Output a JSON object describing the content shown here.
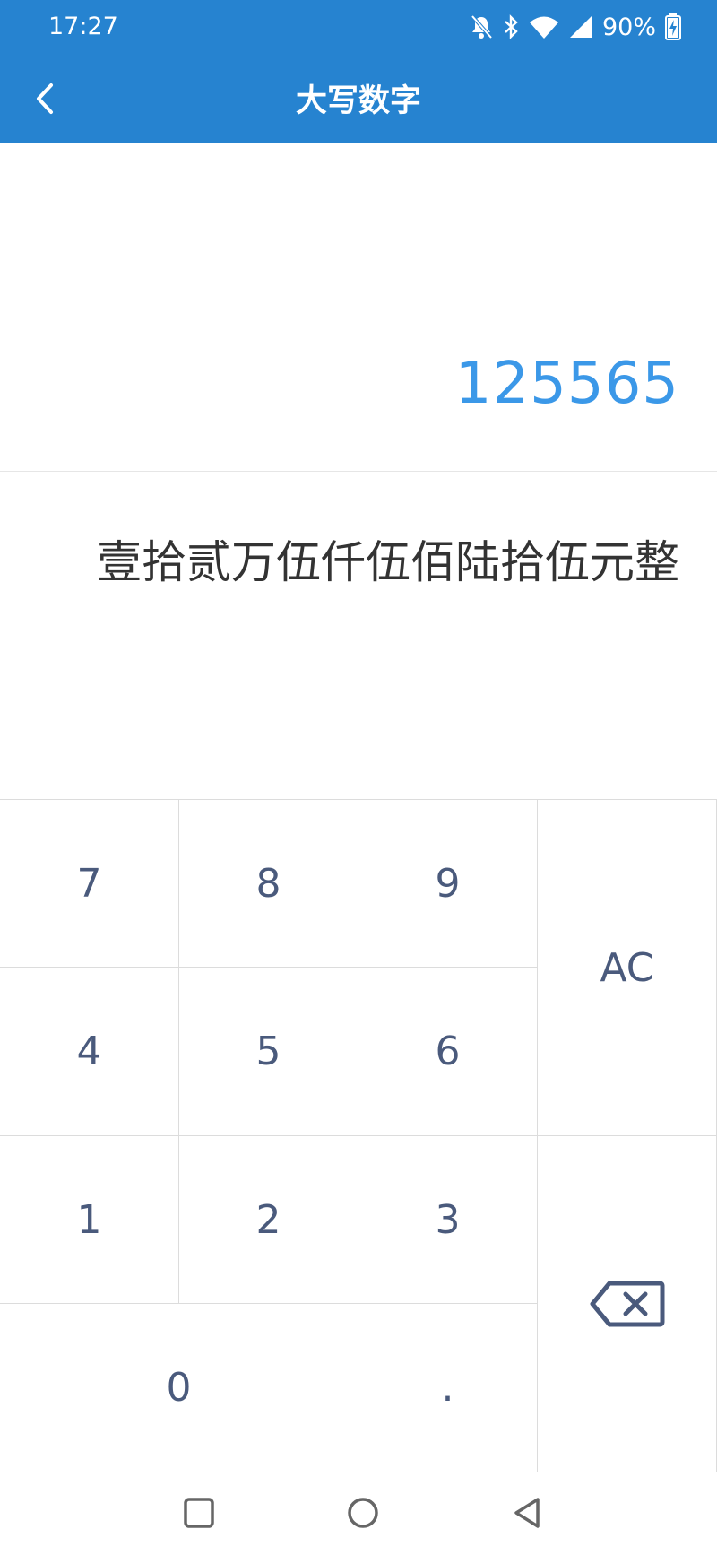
{
  "status_bar": {
    "time": "17:27",
    "battery": "90%"
  },
  "header": {
    "title": "大写数字"
  },
  "display": {
    "number": "125565",
    "chinese": "壹拾贰万伍仟伍佰陆拾伍元整"
  },
  "keypad": {
    "k7": "7",
    "k8": "8",
    "k9": "9",
    "k4": "4",
    "k5": "5",
    "k6": "6",
    "k1": "1",
    "k2": "2",
    "k3": "3",
    "k0": "0",
    "dot": ".",
    "ac": "AC",
    "backspace_icon": "backspace-icon"
  },
  "colors": {
    "appbar": "#2683d0",
    "number": "#3b98e8",
    "key_text": "#4a5a7c"
  }
}
